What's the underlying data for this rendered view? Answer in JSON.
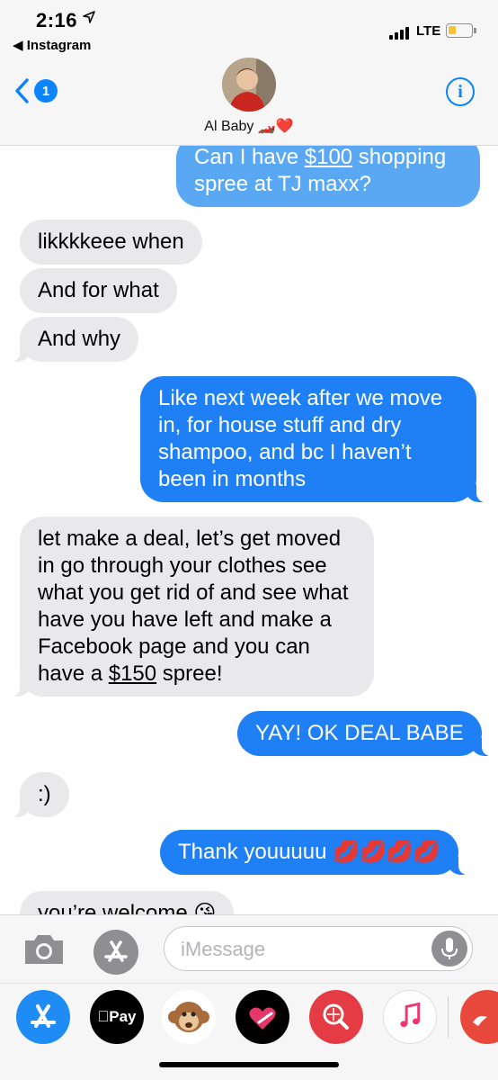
{
  "status_bar": {
    "time": "2:16",
    "back_app": "◀ Instagram",
    "carrier": "LTE"
  },
  "header": {
    "unread_count": "1",
    "contact_name": "Al Baby 🏎️❤️",
    "info_label": "i"
  },
  "messages": [
    {
      "direction": "out",
      "text_before": "Can I have ",
      "link": "$100",
      "text_after": " shopping spree at TJ maxx?"
    },
    {
      "direction": "in",
      "text": "likkkkeee when"
    },
    {
      "direction": "in",
      "text": "And for what"
    },
    {
      "direction": "in",
      "text": "And why"
    },
    {
      "direction": "out",
      "text": "Like next week after we move in, for house stuff and dry shampoo, and bc I haven’t been in months"
    },
    {
      "direction": "in",
      "text_before": "let make a deal, let’s get moved in go through your clothes see what you get rid of and see what have you have left and make a Facebook page and you can have a ",
      "link": "$150",
      "text_after": " spree!"
    },
    {
      "direction": "out",
      "text": "YAY! OK DEAL BABE"
    },
    {
      "direction": "in",
      "text": ":)"
    },
    {
      "direction": "out",
      "text": "Thank youuuuu 💋💋💋💋"
    },
    {
      "direction": "in",
      "text": "you’re welcome 😘"
    }
  ],
  "input": {
    "placeholder": "iMessage"
  },
  "app_drawer": {
    "apps": [
      "app-store-icon",
      "apple-pay-icon",
      "monkey-animoji-icon",
      "digital-touch-icon",
      "web-images-icon",
      "music-icon",
      "partial-app-icon"
    ],
    "pay_label": "Pay"
  },
  "colors": {
    "outgoing": "#1f7ff5",
    "incoming": "#e9e9eb",
    "accent": "#0a84ff"
  }
}
